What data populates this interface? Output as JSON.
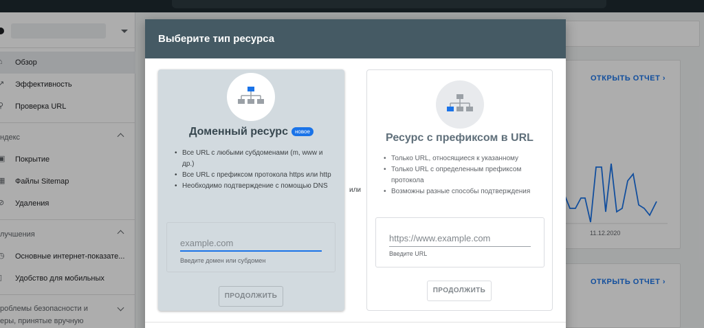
{
  "sidebar": {
    "items": [
      {
        "label": "Обзор",
        "icon": "home-icon"
      },
      {
        "label": "Эффективность",
        "icon": "trending-icon"
      },
      {
        "label": "Проверка URL",
        "icon": "search-icon"
      }
    ],
    "section_index": {
      "title": "ндекс"
    },
    "index_items": [
      {
        "label": "Покрытие",
        "icon": "file-icon"
      },
      {
        "label": "Файлы Sitemap",
        "icon": "sitemap-icon"
      },
      {
        "label": "Удаления",
        "icon": "eye-off-icon"
      }
    ],
    "section_enhancements": {
      "title": "лучшения"
    },
    "enh_items": [
      {
        "label": "Основные интернет-показате...",
        "icon": "speed-icon"
      },
      {
        "label": "Удобство для мобильных",
        "icon": "phone-icon"
      }
    ],
    "section_security": {
      "line1": "роблемы безопасности и",
      "line2": "еры, принятые вручную"
    }
  },
  "background": {
    "open_report_1": "ОТКРЫТЬ ОТЧЕТ",
    "open_report_2": "ОТКРЫТЬ ОТЧЕТ",
    "chart_date": "11.12.2020"
  },
  "dialog": {
    "title": "Выберите тип ресурса",
    "or_label": "или",
    "domain": {
      "title": "Доменный ресурс",
      "badge": "новое",
      "bullets": [
        "Все URL с любыми субдоменами (m, www и др.)",
        "Все URL с префиксом протокола https или http",
        "Необходимо подтверждение с помощью DNS"
      ],
      "placeholder": "example.com",
      "hint": "Введите домен или субдомен",
      "button": "ПРОДОЛЖИТЬ"
    },
    "prefix": {
      "title": "Ресурс с префиксом в URL",
      "bullets": [
        "Только URL, относящиеся к указанному",
        "Только URL с определенным префиксом протокола",
        "Возможны разные способы подтверждения"
      ],
      "placeholder": "https://www.example.com",
      "hint": "Введите URL",
      "button": "ПРОДОЛЖИТЬ"
    }
  },
  "colors": {
    "header": "#455a64",
    "accent": "#1a73e8",
    "domain_card": "#d2dadf"
  }
}
